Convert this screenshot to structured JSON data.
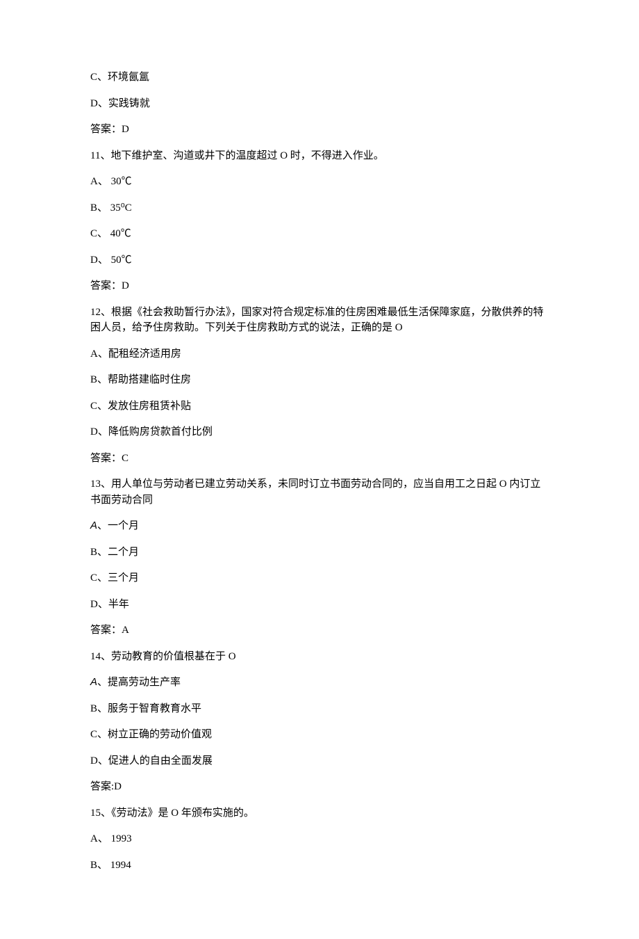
{
  "lines": [
    "C、环境氤氲",
    "D、实践铸就",
    "答案：D",
    "11、地下维护室、沟道或井下的温度超过 O 时，不得进入作业。",
    "A、 30℃",
    "B、 35⁰C",
    "C、 40℃",
    "D、 50℃",
    "答案：D",
    "12、根据《社会救助暂行办法》，国家对符合规定标准的住房困难最低生活保障家庭，分散供养的特困人员，给予住房救助。下列关于住房救助方式的说法，正确的是 O",
    "A、配租经济适用房",
    "B、帮助搭建临时住房",
    "C、发放住房租赁补贴",
    "D、降低购房贷款首付比例",
    "答案：C",
    "13、用人单位与劳动者已建立劳动关系，未同时订立书面劳动合同的，应当自用工之日起 O 内订立书面劳动合同",
    "",
    "B、二个月",
    "C、三个月",
    "D、半年",
    "答案：A",
    "14、劳动教育的价值根基在于 O",
    "",
    "B、服务于智育教育水平",
    "C、树立正确的劳动价值观",
    "D、促进人的自由全面发展",
    "答案:D",
    "15、《劳动法》是 O 年颁布实施的。",
    "A、 1993",
    "B、 1994"
  ],
  "special": {
    "a_one_month_prefix": "A",
    "a_one_month_suffix": "、一个月",
    "a_increase_prefix": "A",
    "a_increase_suffix": "、提高劳动生产率"
  }
}
